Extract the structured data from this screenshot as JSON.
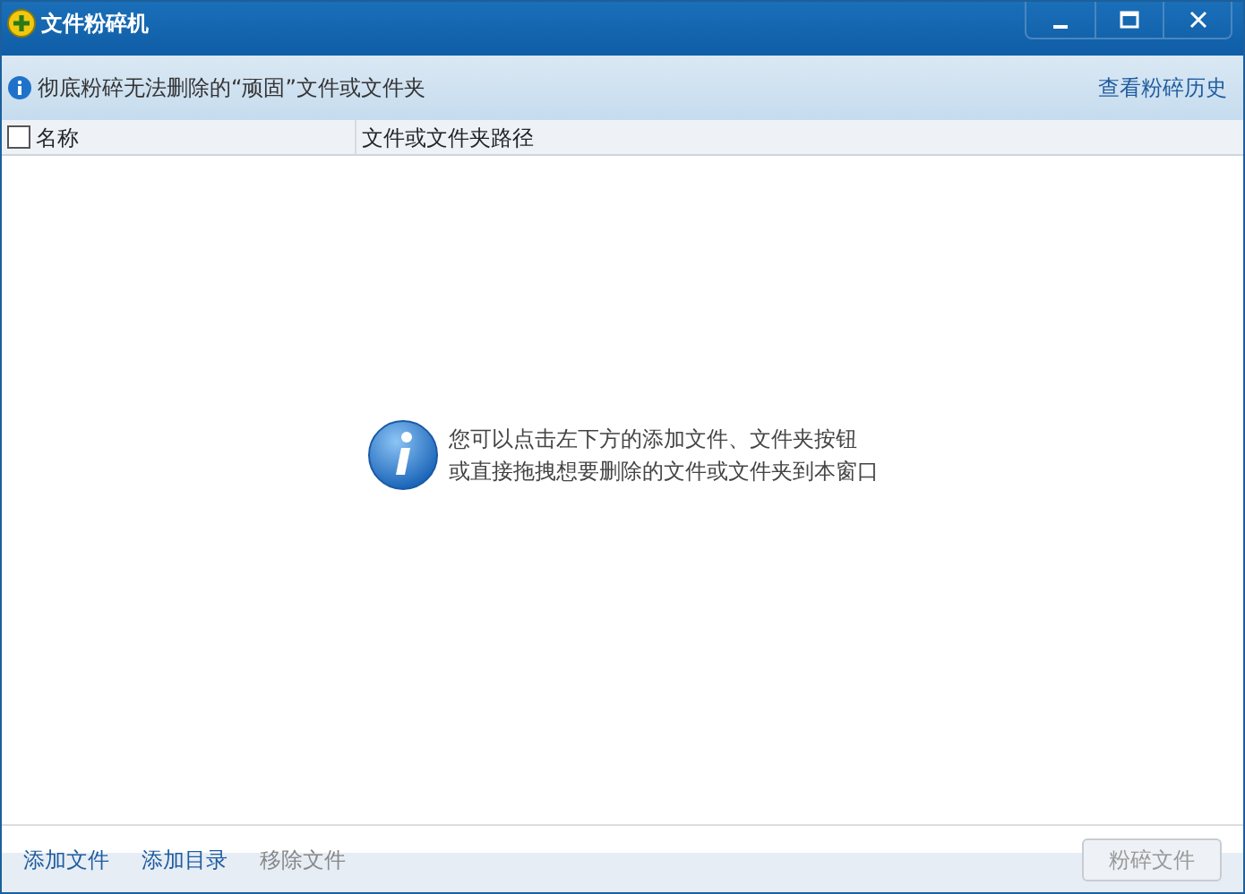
{
  "window": {
    "title": "文件粉碎机"
  },
  "info_bar": {
    "text": "彻底粉碎无法删除的“顽固”文件或文件夹",
    "link": "查看粉碎历史"
  },
  "table": {
    "select_all": {
      "checked": false
    },
    "columns": [
      "名称",
      "文件或文件夹路径"
    ]
  },
  "empty_message": [
    "您可以点击左下方的添加文件、文件夹按钮",
    "或直接拖拽想要删除的文件或文件夹到本窗口"
  ],
  "actions": [
    {
      "label": "添加文件",
      "disabled": false
    },
    {
      "label": "添加目录",
      "disabled": false
    },
    {
      "label": "移除文件",
      "disabled": true
    }
  ],
  "primary_button": {
    "label": "粉碎文件",
    "disabled": true
  }
}
